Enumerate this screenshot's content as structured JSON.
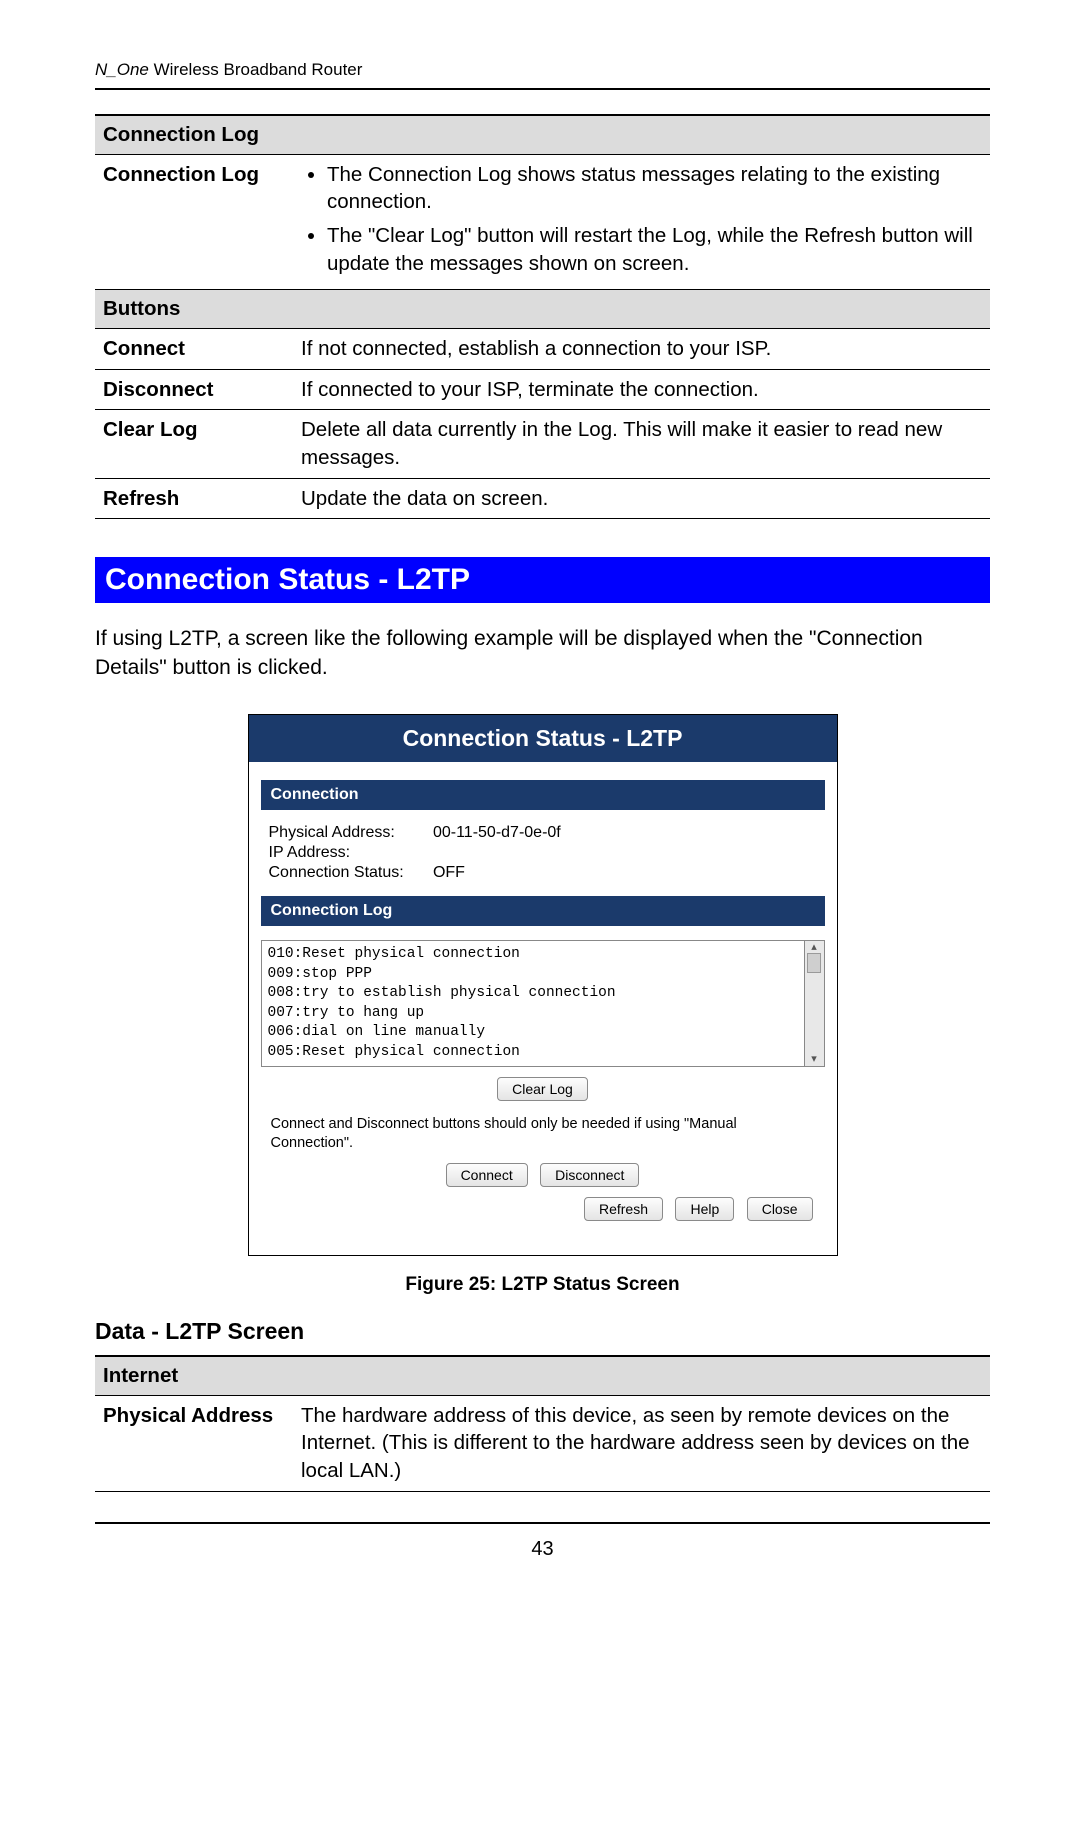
{
  "header": {
    "em": "N_One",
    "rest": " Wireless Broadband Router"
  },
  "table1": {
    "section1": "Connection Log",
    "r1_label": "Connection Log",
    "r1_b1": "The Connection Log shows status messages relating to the existing connection.",
    "r1_b2": "The \"Clear Log\" button will restart the Log, while the Refresh button will update the messages shown on screen.",
    "section2": "Buttons",
    "r2_label": "Connect",
    "r2_text": "If not connected, establish a connection to your ISP.",
    "r3_label": "Disconnect",
    "r3_text": "If connected to your ISP, terminate the connection.",
    "r4_label": "Clear Log",
    "r4_text": "Delete all data currently in the Log. This will make it easier to read new messages.",
    "r5_label": "Refresh",
    "r5_text": "Update the data on screen."
  },
  "heading": "Connection Status - L2TP",
  "intro": "If using L2TP, a screen like the following example will be displayed when the \"Connection Details\" button is clicked.",
  "shot": {
    "title": "Connection Status - L2TP",
    "sec_conn": "Connection",
    "phys_k": "Physical Address:",
    "phys_v": "00-11-50-d7-0e-0f",
    "ip_k": "IP Address:",
    "ip_v": "",
    "stat_k": "Connection Status:",
    "stat_v": "OFF",
    "sec_log": "Connection Log",
    "log_lines": "010:Reset physical connection\n009:stop PPP\n008:try to establish physical connection\n007:try to hang up\n006:dial on line manually\n005:Reset physical connection",
    "btn_clear": "Clear Log",
    "note": "Connect and Disconnect buttons should only be needed if using \"Manual Connection\".",
    "btn_connect": "Connect",
    "btn_disconnect": "Disconnect",
    "btn_refresh": "Refresh",
    "btn_help": "Help",
    "btn_close": "Close"
  },
  "figcap": "Figure 25: L2TP Status Screen",
  "subheading": "Data - L2TP Screen",
  "table2": {
    "section1": "Internet",
    "r1_label": "Physical Address",
    "r1_text": "The hardware address of this device, as seen by remote devices on the Internet. (This is different to the hardware address seen by devices on the local LAN.)"
  },
  "page_no": "43"
}
